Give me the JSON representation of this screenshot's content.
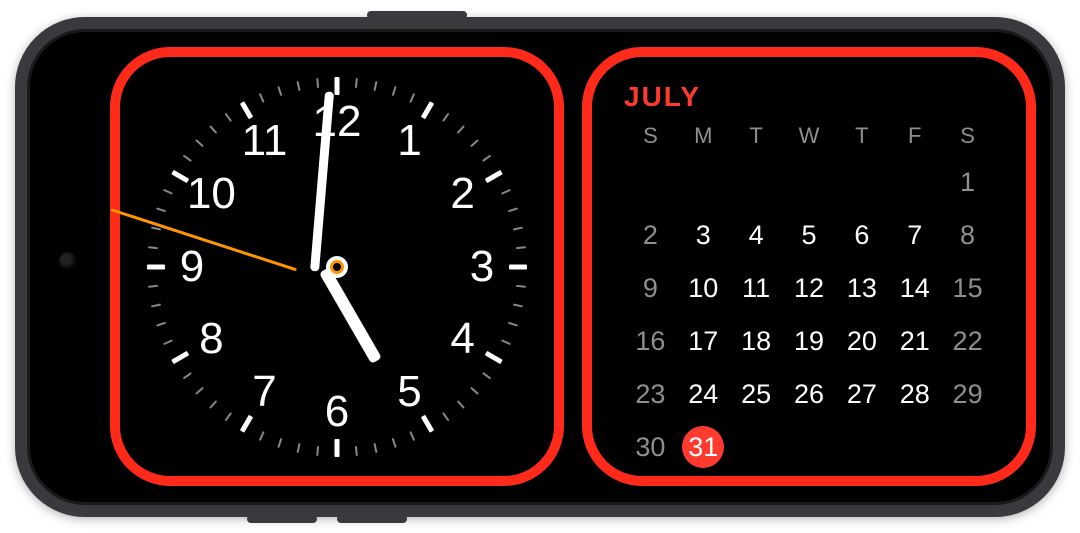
{
  "clock": {
    "numerals": [
      "12",
      "1",
      "2",
      "3",
      "4",
      "5",
      "6",
      "7",
      "8",
      "9",
      "10",
      "11"
    ],
    "time": {
      "hours": 5,
      "minutes": 0,
      "seconds": 48
    },
    "colors": {
      "hands": "#ffffff",
      "second_hand": "#ff9500",
      "ticks_minor": "#888888"
    }
  },
  "calendar": {
    "month_label": "JULY",
    "day_headers": [
      "S",
      "M",
      "T",
      "W",
      "T",
      "F",
      "S"
    ],
    "first_weekday_index": 6,
    "days_in_month": 31,
    "today": 31,
    "colors": {
      "accent": "#ff3b30",
      "weekend": "#8e8e93"
    }
  },
  "annotation": {
    "highlight_color": "#ff2a1a"
  }
}
